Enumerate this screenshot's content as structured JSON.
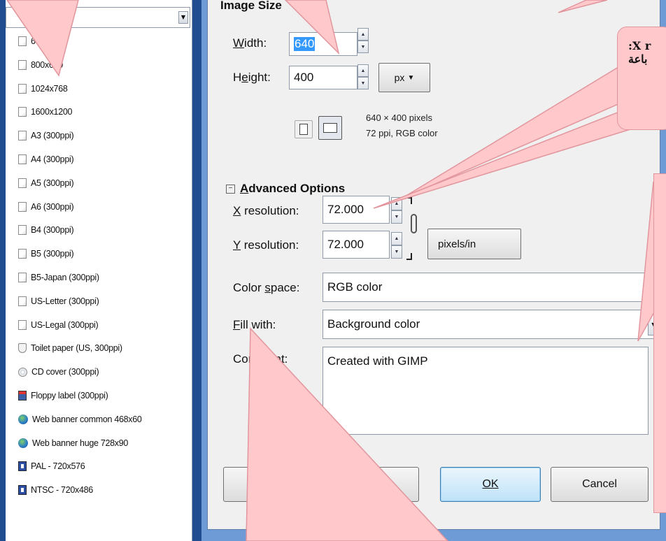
{
  "templates": {
    "combo_value": "",
    "items": [
      {
        "label": "640x480",
        "icon": "page-icon"
      },
      {
        "label": "800x600",
        "icon": "page-icon"
      },
      {
        "label": "1024x768",
        "icon": "page-icon"
      },
      {
        "label": "1600x1200",
        "icon": "page-icon"
      },
      {
        "label": "A3 (300ppi)",
        "icon": "page-icon"
      },
      {
        "label": "A4 (300ppi)",
        "icon": "page-icon"
      },
      {
        "label": "A5 (300ppi)",
        "icon": "page-icon"
      },
      {
        "label": "A6 (300ppi)",
        "icon": "page-icon"
      },
      {
        "label": "B4 (300ppi)",
        "icon": "page-icon"
      },
      {
        "label": "B5 (300ppi)",
        "icon": "page-icon"
      },
      {
        "label": "B5-Japan (300ppi)",
        "icon": "page-icon"
      },
      {
        "label": "US-Letter (300ppi)",
        "icon": "page-icon"
      },
      {
        "label": "US-Legal (300ppi)",
        "icon": "page-icon"
      },
      {
        "label": "Toilet paper (US, 300ppi)",
        "icon": "toilet-paper-icon"
      },
      {
        "label": "CD cover (300ppi)",
        "icon": "cd-icon"
      },
      {
        "label": "Floppy label (300ppi)",
        "icon": "floppy-icon"
      },
      {
        "label": "Web banner common 468x60",
        "icon": "globe-icon"
      },
      {
        "label": "Web banner huge 728x90",
        "icon": "globe-icon"
      },
      {
        "label": "PAL - 720x576",
        "icon": "video-icon"
      },
      {
        "label": "NTSC - 720x486",
        "icon": "video-icon"
      }
    ]
  },
  "image_size": {
    "heading": "Image Size",
    "width_label": "Width:",
    "width_value": "640",
    "height_label": "Height:",
    "height_value": "400",
    "unit": "px",
    "info_line1": "640 × 400 pixels",
    "info_line2": "72 ppi, RGB color"
  },
  "advanced": {
    "heading": "Advanced Options",
    "x_res_label": "X resolution:",
    "x_res_value": "72.000",
    "y_res_label": "Y resolution:",
    "y_res_value": "72.000",
    "res_unit": "pixels/in",
    "color_space_label": "Color space:",
    "color_space_value": "RGB color",
    "fill_label": "Fill with:",
    "fill_value": "Background color",
    "comment_label": "Comment:",
    "comment_value": "Created with GIMP"
  },
  "buttons": {
    "ok": "OK",
    "cancel": "Cancel"
  },
  "callout": {
    "line1": ":X r",
    "line2": "باعة"
  },
  "colors": {
    "callout_fill": "#ffc9cc",
    "callout_border": "#e2959c",
    "selection": "#3399ff",
    "frame": "#6e9ad6"
  }
}
